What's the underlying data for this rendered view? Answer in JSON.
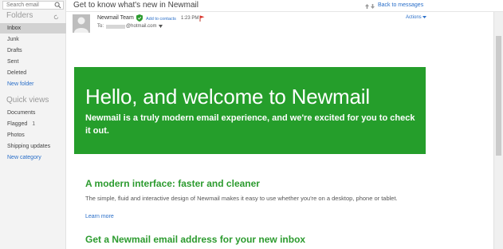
{
  "sidebar": {
    "search_placeholder": "Search email",
    "folders_heading": "Folders",
    "folders": [
      {
        "label": "Inbox",
        "selected": true
      },
      {
        "label": "Junk"
      },
      {
        "label": "Drafts"
      },
      {
        "label": "Sent"
      },
      {
        "label": "Deleted"
      }
    ],
    "new_folder": "New folder",
    "quick_heading": "Quick views",
    "quick_views": [
      {
        "label": "Documents",
        "count": ""
      },
      {
        "label": "Flagged",
        "count": "1"
      },
      {
        "label": "Photos",
        "count": ""
      },
      {
        "label": "Shipping updates",
        "count": ""
      }
    ],
    "new_category": "New category"
  },
  "message": {
    "subject": "Get to know what's new in Newmail",
    "back_link": "Back to messages",
    "sender": "Newmail Team",
    "add_contact": "Add to contacts",
    "time": "1:23 PM",
    "to_label": "To:",
    "to_domain": "@hotmail.com",
    "actions": "Actions"
  },
  "banner": {
    "title": "Hello, and welcome to Newmail",
    "subtitle": "Newmail is a truly modern email experience, and we're excited for you to check it out.",
    "color": "#259e2b"
  },
  "body": {
    "section1_title": "A modern interface: faster and cleaner",
    "section1_text": "The simple, fluid and interactive design of Newmail makes it easy to use whether you're on a desktop, phone or tablet.",
    "learn_more": "Learn more",
    "section2_title": "Get a Newmail email address for your new inbox"
  },
  "colors": {
    "accent_green": "#2c9b2f",
    "link_blue": "#2a6fc9"
  }
}
